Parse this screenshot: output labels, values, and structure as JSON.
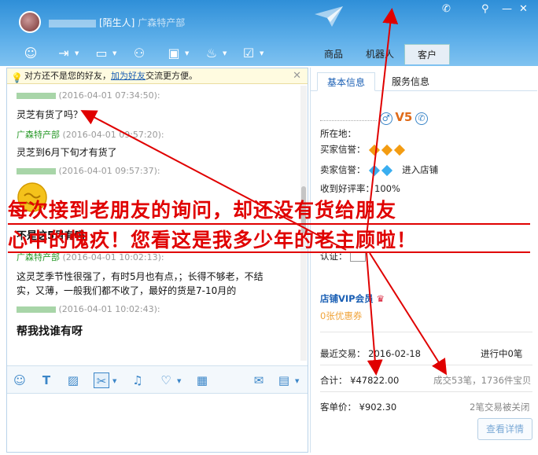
{
  "titlebar": {
    "contact_tag": "[陌生人]",
    "contact_rest": "广森特产部"
  },
  "toolbar": {
    "right_tabs": [
      {
        "label": "商品"
      },
      {
        "label": "机器人"
      },
      {
        "label": "客户"
      }
    ]
  },
  "chat": {
    "notice": {
      "prefix": "对方还不是您的好友，",
      "link": "加为好友",
      "suffix": "交流更方便。"
    },
    "messages": [
      {
        "time": "(2016-04-01 07:34:50):",
        "body": "灵芝有货了吗？"
      },
      {
        "sender": "广森特产部",
        "time": "(2016-04-01 09:57:20):",
        "body": "灵芝到6月下旬才有货了"
      },
      {
        "time": "(2016-04-01 09:57:37):",
        "body": "不是这5月有吗"
      },
      {
        "sender": "广森特产部",
        "time": "(2016-04-01 10:02:13):",
        "body": "这灵芝季节性很强了，有时5月也有点，；长得不够老，不结",
        "body2": "实，又薄，一般我们都不收了，最好的货是7-10月的"
      },
      {
        "time": "(2016-04-01 10:02:43):",
        "body": "帮我找谁有呀"
      }
    ]
  },
  "overlay": {
    "line1": "每次接到老朋友的询问，却还没有货给朋友",
    "line2": "心中的愧疚！您看这是我多少年的老主顾啦！"
  },
  "profile": {
    "tabs": [
      {
        "label": "基本信息"
      },
      {
        "label": "服务信息"
      }
    ],
    "location_label": "所在地：",
    "buyer_credit_label": "买家信誉：",
    "seller_credit_label": "卖家信誉：",
    "enter_store": "进入店铺",
    "good_rate": "收到好评率：100%",
    "auth_label": "认证：",
    "vip_title": "店铺VIP会员",
    "coupon": "0张优惠券",
    "recent_trade_label": "最近交易：",
    "recent_trade_date": "2016-02-18",
    "in_progress": "进行中0笔",
    "total_label": "合计：",
    "total_value": "¥47822.00",
    "deals": "成交53笔，1736件宝贝",
    "unit_price_label": "客单价：",
    "unit_price_value": "¥902.30",
    "closed": "2笔交易被关闭",
    "detail_button": "查看详情"
  },
  "colors": {
    "accent": "#2f8fd8",
    "overlay_red": "#e00000",
    "sender_green": "#2a9a2a"
  }
}
